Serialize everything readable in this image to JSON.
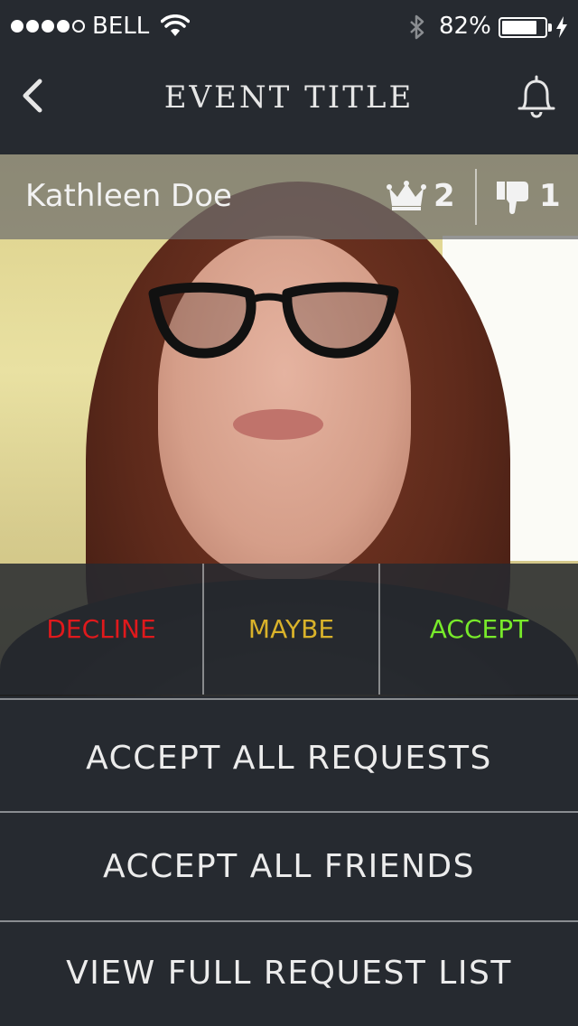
{
  "status_bar": {
    "carrier": "BELL",
    "battery_percent_text": "82%",
    "battery_level": 0.82,
    "signal_bars": 4,
    "signal_total": 5,
    "icons": [
      "wifi-icon",
      "bluetooth-icon",
      "battery-icon",
      "charging-bolt-icon"
    ]
  },
  "nav": {
    "title": "EVENT TITLE",
    "icons": [
      "back-chevron-icon",
      "bell-icon"
    ]
  },
  "profile": {
    "name": "Kathleen Doe",
    "crown_count": "2",
    "thumbs_down_count": "1",
    "icons": [
      "crown-icon",
      "thumbs-down-icon"
    ]
  },
  "rsvp": {
    "decline_label": "DECLINE",
    "maybe_label": "MAYBE",
    "accept_label": "ACCEPT"
  },
  "actions": {
    "accept_all_requests": "ACCEPT ALL REQUESTS",
    "accept_all_friends": "ACCEPT ALL FRIENDS",
    "view_full_list": "VIEW FULL REQUEST LIST"
  },
  "colors": {
    "background": "#262a30",
    "decline": "#e0191c",
    "maybe": "#d9b22a",
    "accept": "#78ea2a"
  }
}
